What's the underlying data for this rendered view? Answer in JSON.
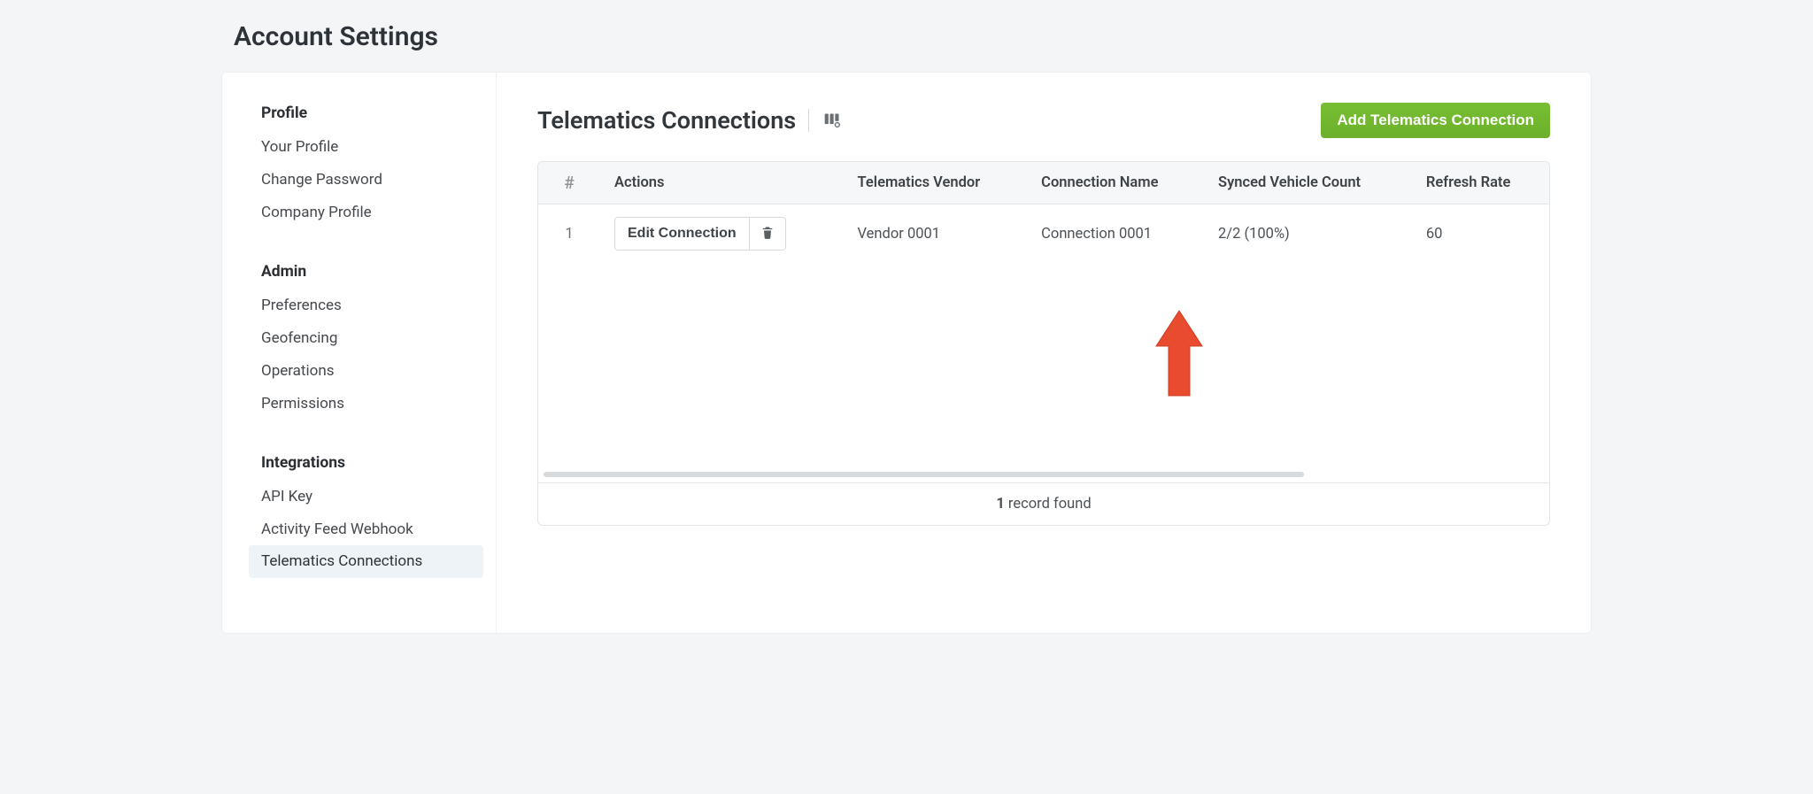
{
  "page_title": "Account Settings",
  "sidebar": {
    "groups": [
      {
        "heading": "Profile",
        "items": [
          {
            "label": "Your Profile",
            "active": false
          },
          {
            "label": "Change Password",
            "active": false
          },
          {
            "label": "Company Profile",
            "active": false
          }
        ]
      },
      {
        "heading": "Admin",
        "items": [
          {
            "label": "Preferences",
            "active": false
          },
          {
            "label": "Geofencing",
            "active": false
          },
          {
            "label": "Operations",
            "active": false
          },
          {
            "label": "Permissions",
            "active": false
          }
        ]
      },
      {
        "heading": "Integrations",
        "items": [
          {
            "label": "API Key",
            "active": false
          },
          {
            "label": "Activity Feed Webhook",
            "active": false
          },
          {
            "label": "Telematics Connections",
            "active": true
          }
        ]
      }
    ]
  },
  "main": {
    "title": "Telematics Connections",
    "add_button": "Add Telematics Connection",
    "columns": {
      "num": "#",
      "actions": "Actions",
      "vendor": "Telematics Vendor",
      "name": "Connection Name",
      "synced": "Synced Vehicle Count",
      "refresh": "Refresh Rate"
    },
    "rows": [
      {
        "num": "1",
        "edit_label": "Edit Connection",
        "vendor": "Vendor 0001",
        "name": "Connection 0001",
        "synced": "2/2 (100%)",
        "refresh": "60"
      }
    ],
    "footer_count": "1",
    "footer_text": " record found"
  }
}
